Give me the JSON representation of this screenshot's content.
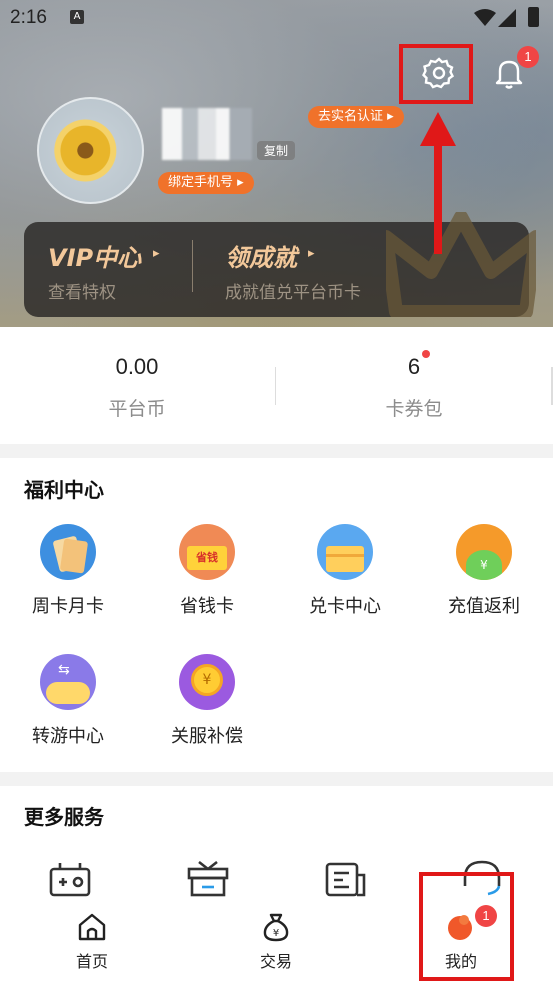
{
  "status_bar": {
    "time": "2:16",
    "notif_letter": "A"
  },
  "header": {
    "notifications_badge": "1",
    "realname_label": "去实名认证 ▸",
    "copy_label": "复制",
    "bind_phone_label": "绑定手机号 ▸"
  },
  "vip_card": {
    "vip_title": "VIP中心",
    "vip_sub": "查看特权",
    "ach_title": "领成就",
    "ach_sub": "成就值兑平台币卡"
  },
  "stats": [
    {
      "value": "0.00",
      "label": "平台币"
    },
    {
      "value": "6",
      "label": "卡券包"
    }
  ],
  "welfare": {
    "title": "福利中心",
    "items": [
      {
        "label": "周卡月卡",
        "icon": "weekly-card-icon"
      },
      {
        "label": "省钱卡",
        "icon": "save-money-card-icon",
        "icon_text": "省钱"
      },
      {
        "label": "兑卡中心",
        "icon": "card-exchange-icon"
      },
      {
        "label": "充值返利",
        "icon": "recharge-rebate-icon",
        "icon_text": "¥"
      },
      {
        "label": "转游中心",
        "icon": "game-transfer-icon"
      },
      {
        "label": "关服补偿",
        "icon": "server-close-compensation-icon",
        "icon_text": "¥"
      }
    ]
  },
  "more_services": {
    "title": "更多服务"
  },
  "bottom_nav": [
    {
      "label": "首页",
      "icon": "home-icon"
    },
    {
      "label": "交易",
      "icon": "money-bag-icon",
      "icon_text": "¥"
    },
    {
      "label": "我的",
      "icon": "profile-blob-icon",
      "badge": "1"
    }
  ],
  "colors": {
    "accent": "#f0722a",
    "badge": "#f04545",
    "annotation": "#e01818",
    "vip_gold": "#f3c89a"
  }
}
